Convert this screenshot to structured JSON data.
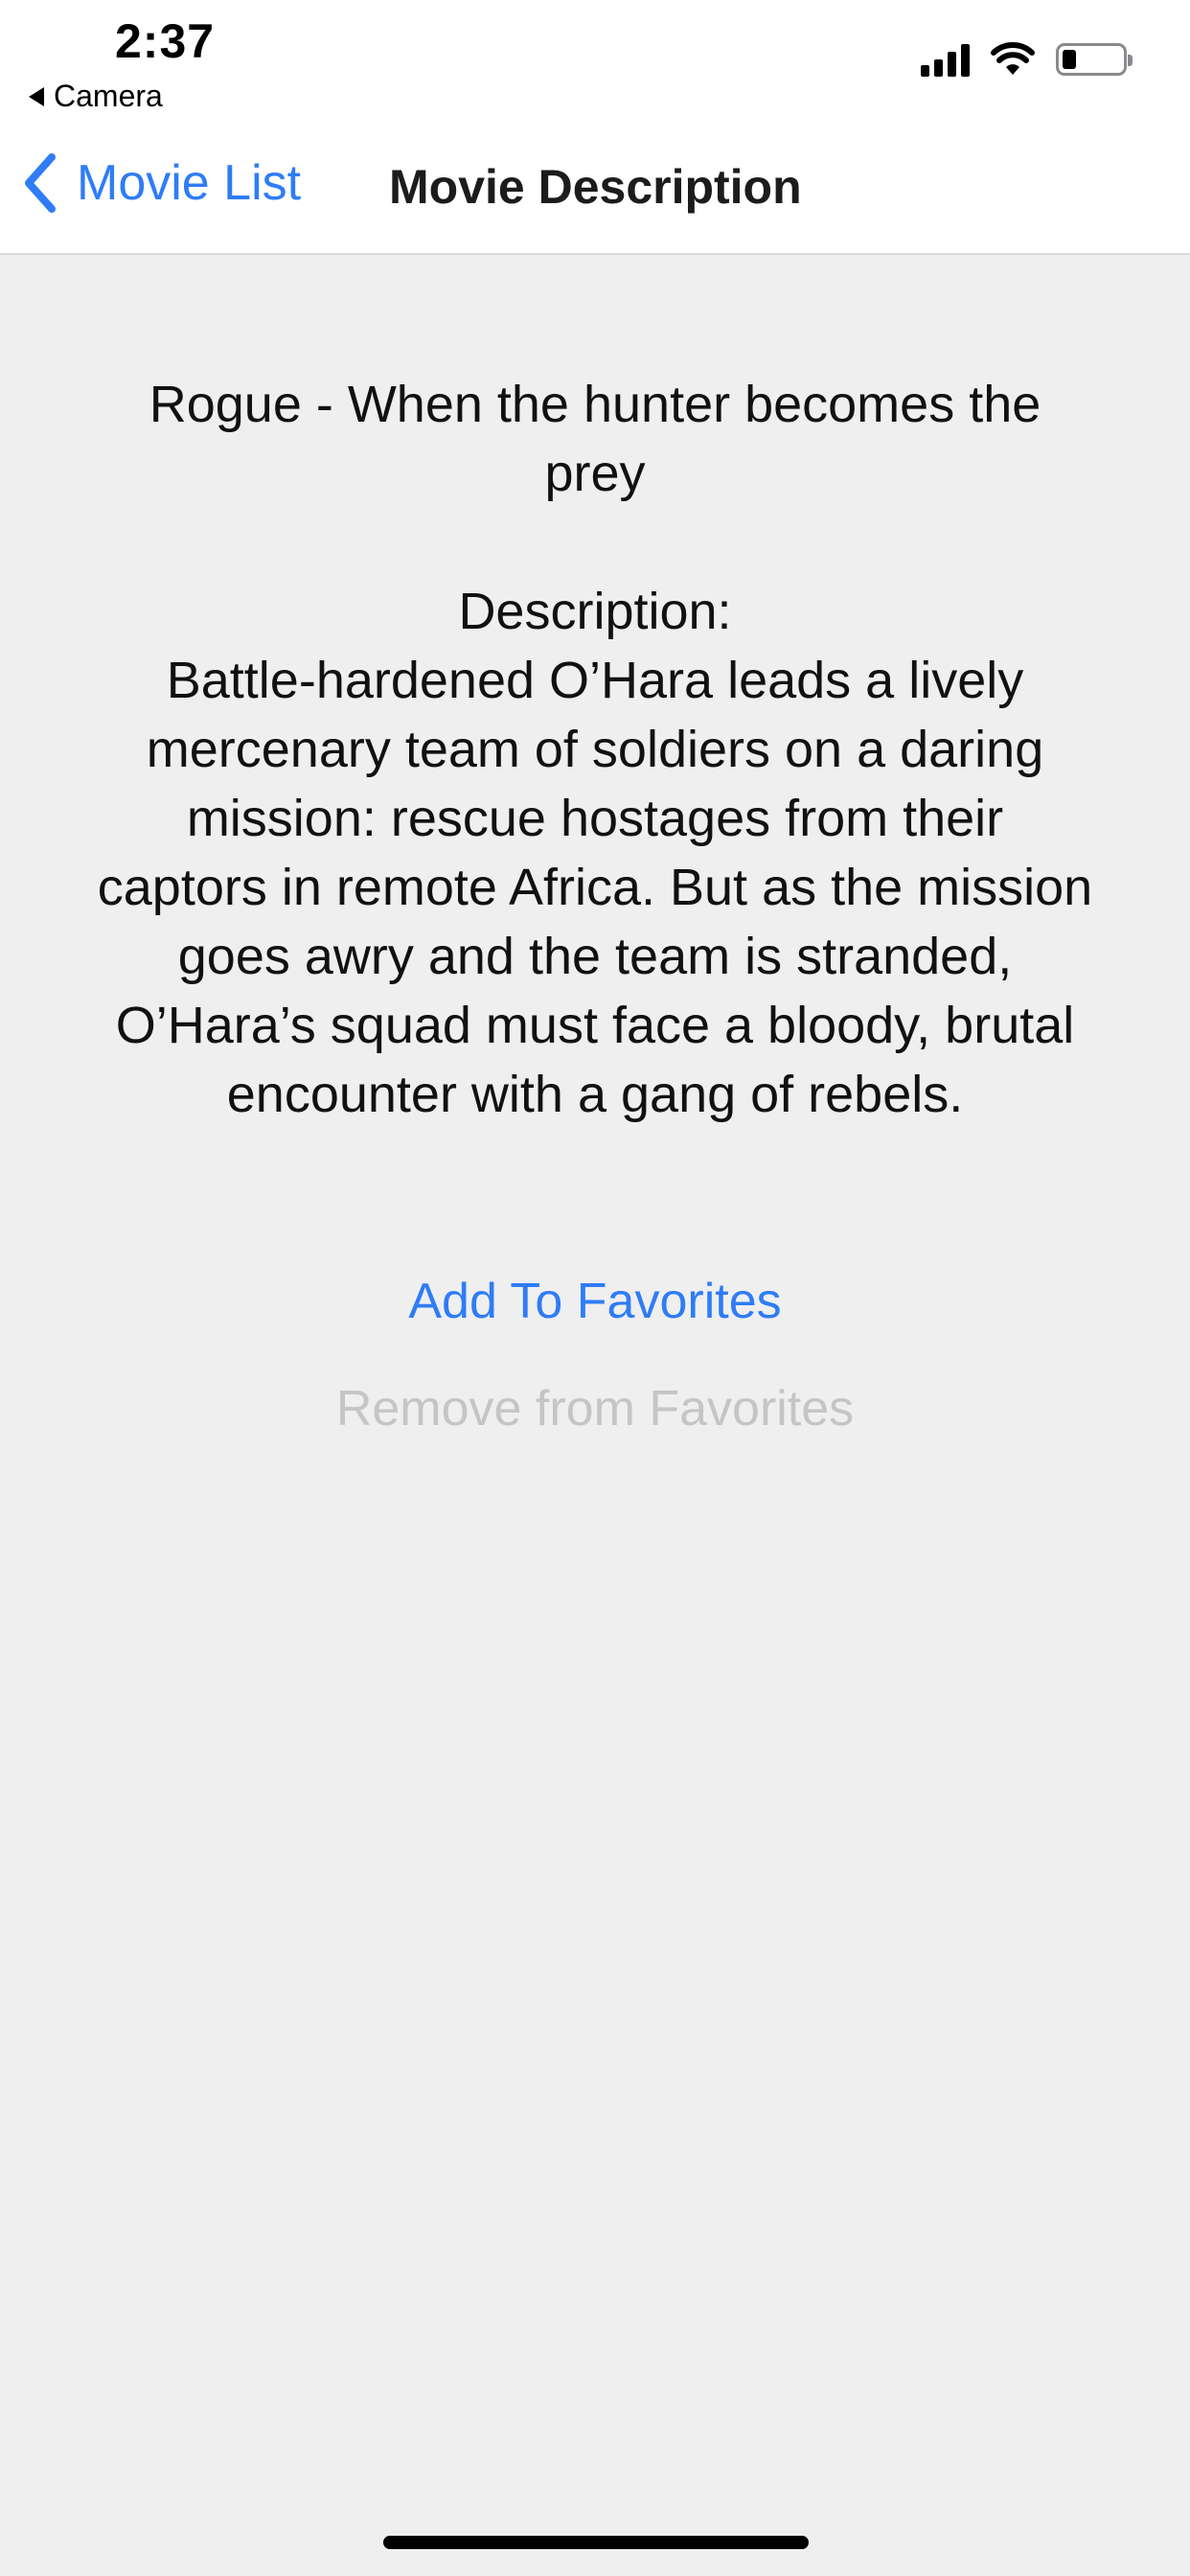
{
  "status_bar": {
    "time": "2:37",
    "back_app": "Camera",
    "icons": [
      "signal-icon",
      "wifi-icon",
      "battery-icon"
    ]
  },
  "nav": {
    "back_label": "Movie List",
    "title": "Movie Description"
  },
  "movie": {
    "title": "Rogue - When the hunter becomes the prey",
    "description_label": "Description:",
    "description": "Battle-hardened O’Hara leads a lively mercenary team of soldiers on a daring mission: rescue hostages from their captors in remote Africa. But as the mission goes awry and the team is stranded, O’Hara’s squad must face a bloody, brutal encounter with a gang of rebels."
  },
  "actions": {
    "add_label": "Add To Favorites",
    "remove_label": "Remove from Favorites"
  },
  "colors": {
    "accent": "#2f7cf6",
    "disabled": "#c5c5c8",
    "background": "#efeff0"
  }
}
